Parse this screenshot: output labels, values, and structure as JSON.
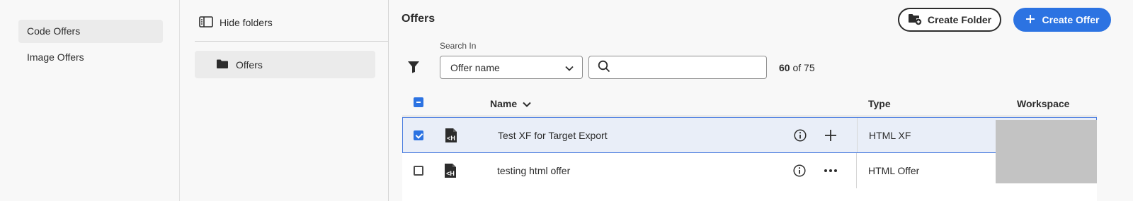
{
  "left_nav": {
    "items": [
      {
        "label": "Code Offers",
        "active": true
      },
      {
        "label": "Image Offers",
        "active": false
      }
    ]
  },
  "folder_panel": {
    "hide_label": "Hide folders",
    "folders": [
      {
        "label": "Offers",
        "selected": true
      }
    ]
  },
  "header": {
    "title": "Offers",
    "create_folder_label": "Create Folder",
    "create_offer_label": "Create Offer"
  },
  "search": {
    "search_in_label": "Search In",
    "selected_field": "Offer name",
    "query": "",
    "placeholder": "",
    "count_shown": "60",
    "count_text": "of 75"
  },
  "table": {
    "columns": {
      "name": "Name",
      "type": "Type",
      "workspace": "Workspace"
    },
    "rows": [
      {
        "name": "Test XF for Target Export",
        "type": "HTML XF",
        "checked": true,
        "action_icon": "move-icon"
      },
      {
        "name": "testing html offer",
        "type": "HTML Offer",
        "checked": false,
        "action_icon": "more-icon"
      }
    ]
  },
  "colors": {
    "accent": "#2c73e2",
    "selected_row_bg": "#e9eef8",
    "workspace_placeholder": "#c3c3c3"
  }
}
